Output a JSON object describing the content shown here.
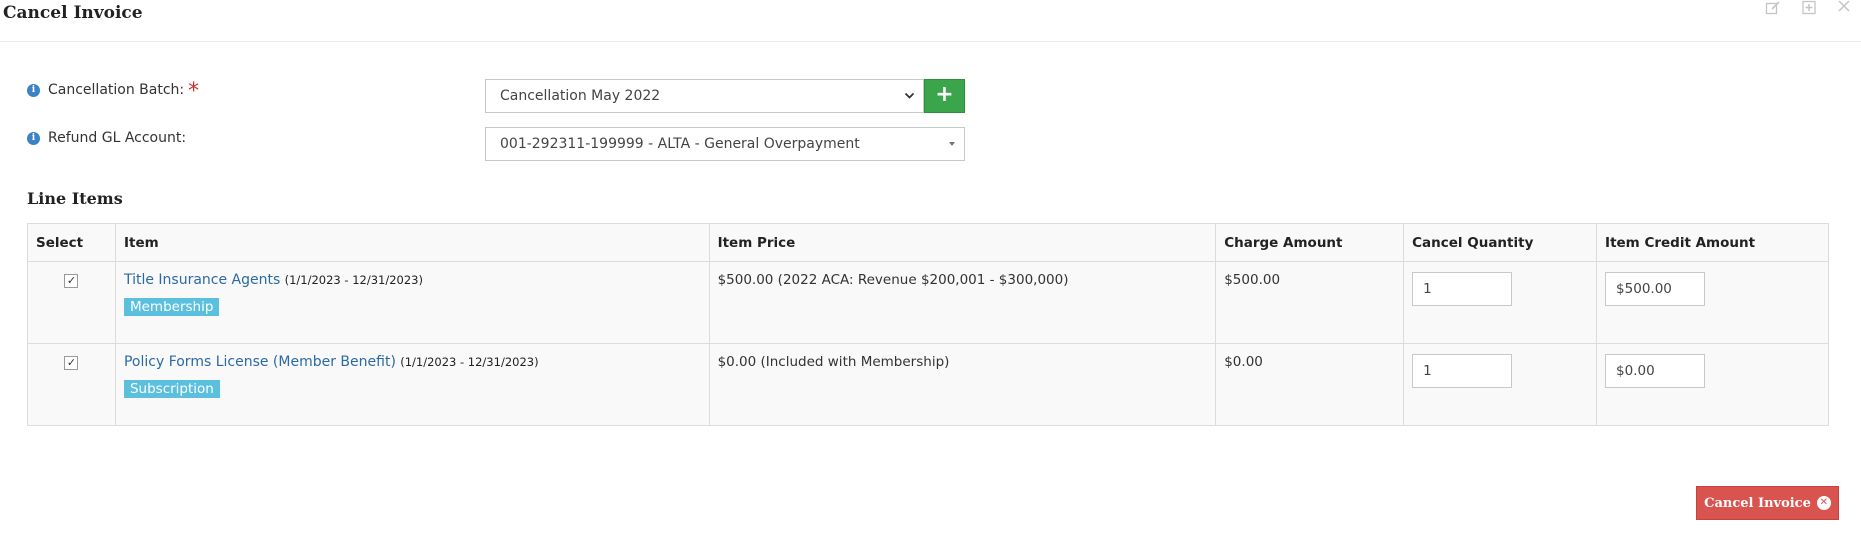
{
  "dialog": {
    "title": "Cancel Invoice"
  },
  "form": {
    "batch_label": "Cancellation Batch:",
    "batch_required_mark": "*",
    "batch_value": "Cancellation May 2022",
    "add_batch_label": "+",
    "gl_label": "Refund GL Account:",
    "gl_value": "001-292311-199999 - ALTA - General Overpayment"
  },
  "line_items": {
    "title": "Line Items",
    "columns": [
      "Select",
      "Item",
      "Item Price",
      "Charge Amount",
      "Cancel Quantity",
      "Item Credit Amount"
    ],
    "rows": [
      {
        "checked": "✓",
        "item_name": "Title Insurance Agents",
        "item_dates": "(1/1/2023 - 12/31/2023)",
        "tag": "Membership",
        "item_price": "$500.00 (2022 ACA: Revenue $200,001 - $300,000)",
        "charge_amount": "$500.00",
        "cancel_quantity": "1",
        "credit_amount": "$500.00"
      },
      {
        "checked": "✓",
        "item_name": "Policy Forms License (Member Benefit)",
        "item_dates": "(1/1/2023 - 12/31/2023)",
        "tag": "Subscription",
        "item_price": "$0.00 (Included with Membership)",
        "charge_amount": "$0.00",
        "cancel_quantity": "1",
        "credit_amount": "$0.00"
      }
    ]
  },
  "actions": {
    "cancel_invoice_label": "Cancel Invoice"
  },
  "colors": {
    "add_button": "#3aa54a",
    "cancel_button": "#d9534f",
    "tag": "#5bc0de",
    "link": "#2b6aa3",
    "info_icon": "#3b82c6"
  }
}
